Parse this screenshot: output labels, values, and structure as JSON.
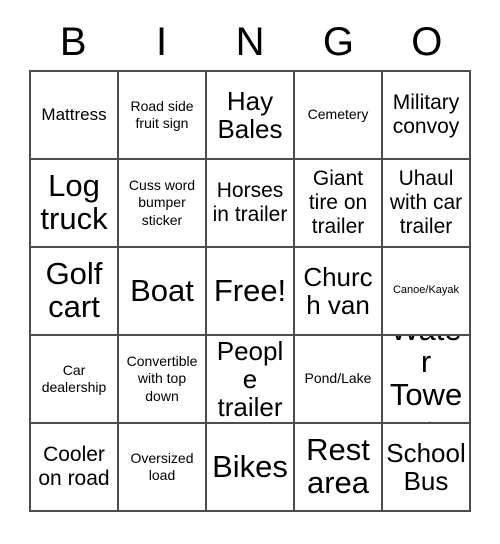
{
  "card": {
    "header_letters": [
      "B",
      "I",
      "N",
      "G",
      "O"
    ],
    "grid": [
      [
        {
          "label": "Mattress",
          "size": "md"
        },
        {
          "label": "Road side fruit sign",
          "size": "sm"
        },
        {
          "label": "Hay Bales",
          "size": "xl"
        },
        {
          "label": "Cemetery",
          "size": "sm"
        },
        {
          "label": "Military convoy",
          "size": "lg"
        }
      ],
      [
        {
          "label": "Log truck",
          "size": "xxl"
        },
        {
          "label": "Cuss word bumper sticker",
          "size": "sm"
        },
        {
          "label": "Horses in trailer",
          "size": "lg"
        },
        {
          "label": "Giant tire on trailer",
          "size": "lg"
        },
        {
          "label": "Uhaul with car trailer",
          "size": "lg"
        }
      ],
      [
        {
          "label": "Golf cart",
          "size": "xxl"
        },
        {
          "label": "Boat",
          "size": "xxl"
        },
        {
          "label": "Free!",
          "size": "xxl"
        },
        {
          "label": "Church van",
          "size": "xl"
        },
        {
          "label": "Canoe/Kayak",
          "size": "xs"
        }
      ],
      [
        {
          "label": "Car dealership",
          "size": "sm"
        },
        {
          "label": "Convertible with top down",
          "size": "sm"
        },
        {
          "label": "People trailer",
          "size": "xl"
        },
        {
          "label": "Pond/Lake",
          "size": "sm"
        },
        {
          "label": "Water Tower",
          "size": "xxl"
        }
      ],
      [
        {
          "label": "Cooler on road",
          "size": "lg"
        },
        {
          "label": "Oversized load",
          "size": "sm"
        },
        {
          "label": "Bikes",
          "size": "xxl"
        },
        {
          "label": "Rest area",
          "size": "xxl"
        },
        {
          "label": "School Bus",
          "size": "xl"
        }
      ]
    ]
  },
  "colors": {
    "border": "#4d4d4d",
    "text": "#000000",
    "background": "#ffffff"
  }
}
